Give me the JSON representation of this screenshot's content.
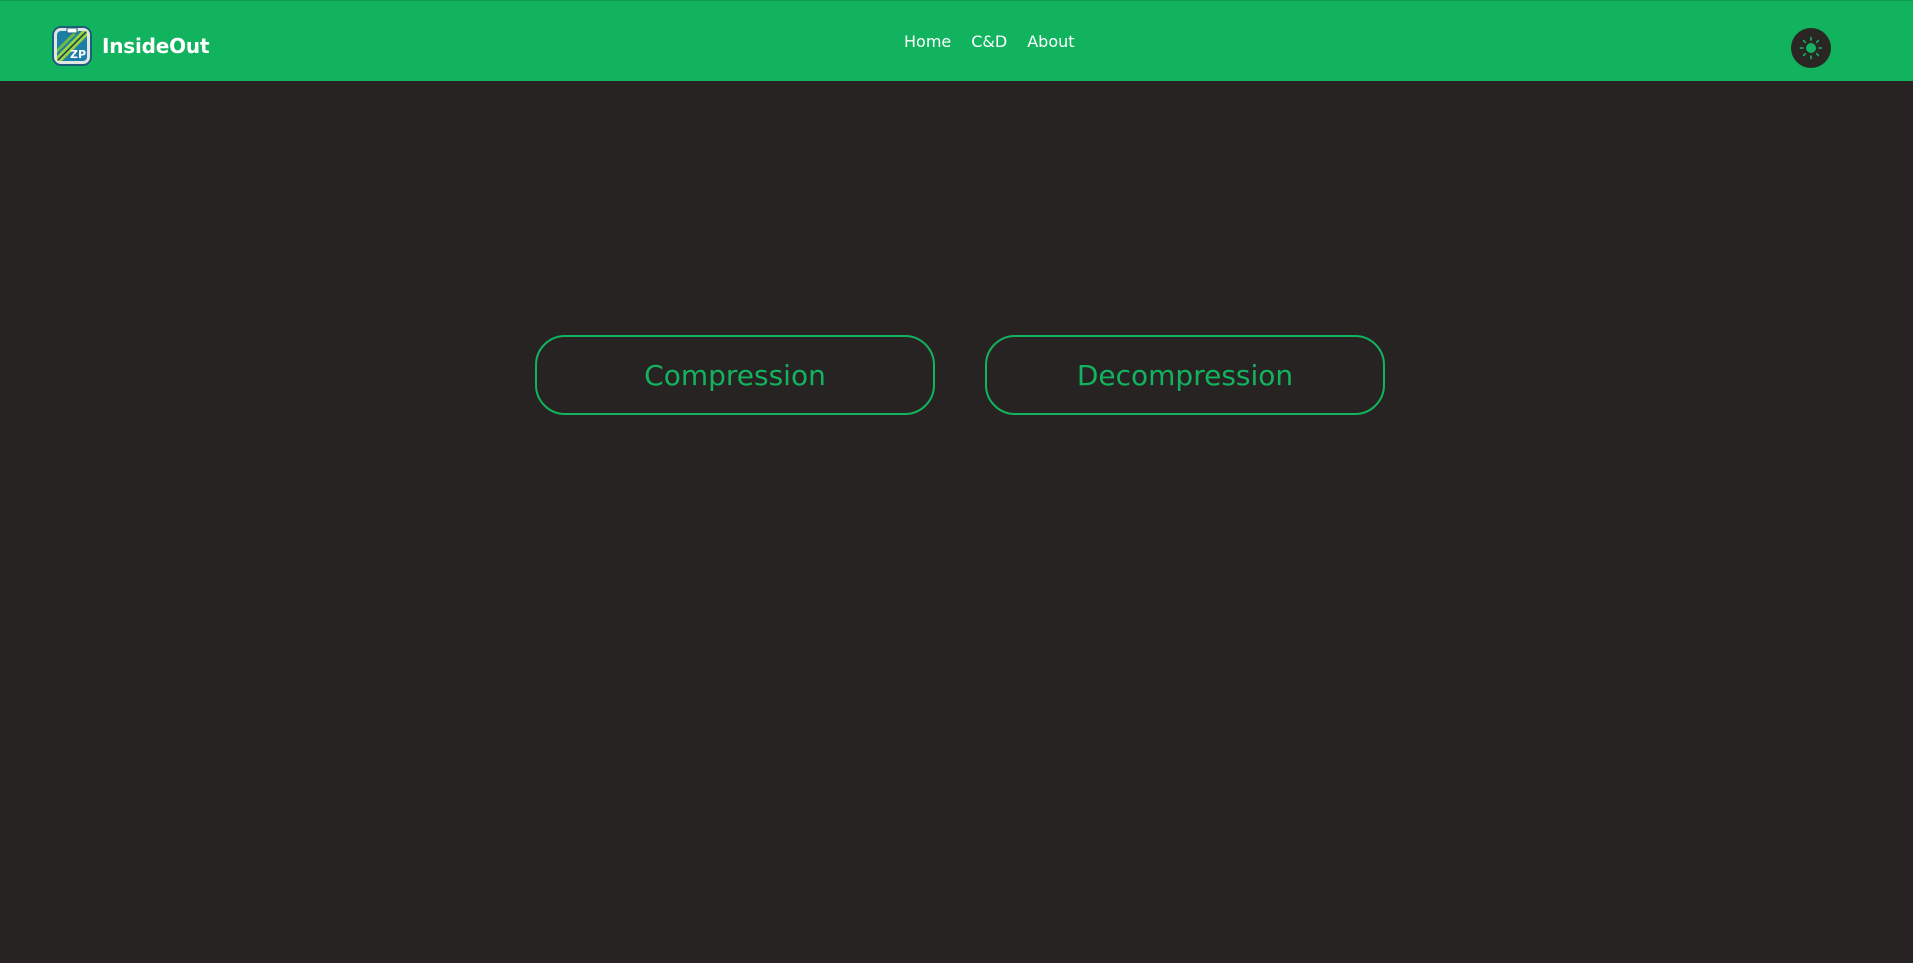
{
  "header": {
    "brand_name": "InsideOut",
    "logo_text": "ZP",
    "nav": [
      {
        "label": "Home"
      },
      {
        "label": "C&D"
      },
      {
        "label": "About"
      }
    ],
    "theme_toggle_icon": "sun-icon"
  },
  "main": {
    "compression_label": "Compression",
    "decompression_label": "Decompression"
  },
  "colors": {
    "accent": "#12b35e",
    "background": "#272322",
    "toggle_bg": "#2a2624"
  }
}
